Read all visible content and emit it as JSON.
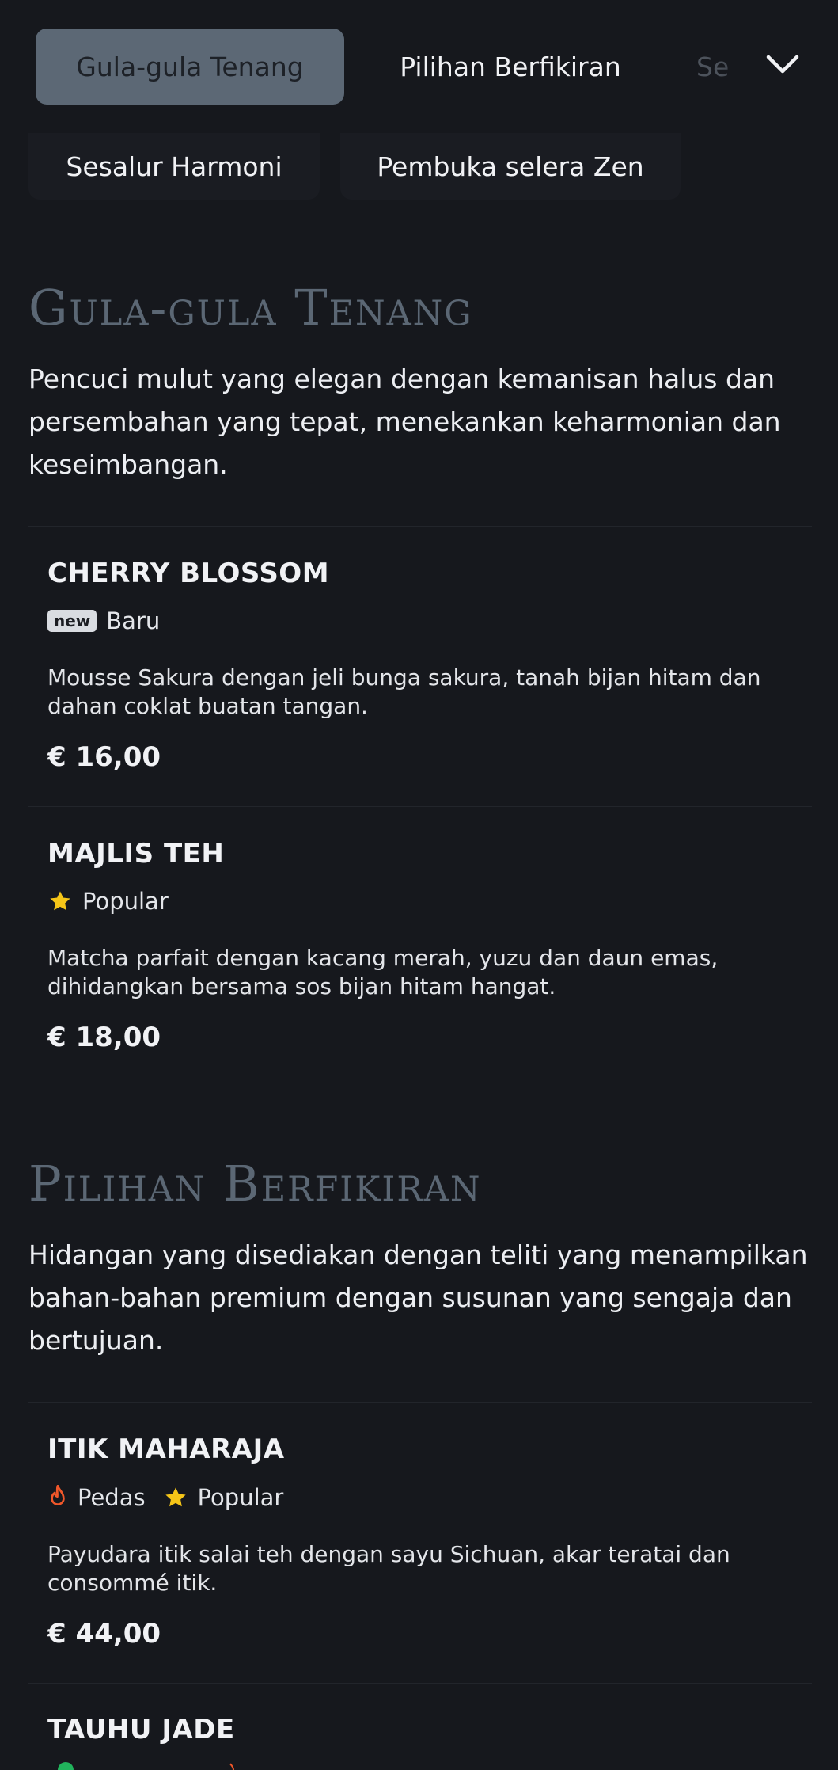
{
  "nav": {
    "categories": [
      {
        "label": "Gula-gula Tenang",
        "active": true
      },
      {
        "label": "Pilihan Berfikiran",
        "active": false
      },
      {
        "label": "Se",
        "active": false
      }
    ],
    "categories_row2": [
      {
        "label": "Sesalur Harmoni"
      },
      {
        "label": "Pembuka selera Zen"
      }
    ]
  },
  "sections": [
    {
      "title": "Gula-gula Tenang",
      "description": "Pencuci mulut yang elegan dengan kemanisan halus dan persembahan yang tepat, menekankan keharmonian dan keseimbangan.",
      "items": [
        {
          "name": "CHERRY BLOSSOM",
          "tags": [
            {
              "icon": "new-badge",
              "badge": "new",
              "label": "Baru"
            }
          ],
          "description": "Mousse Sakura dengan jeli bunga sakura, tanah bijan hitam dan dahan coklat buatan tangan.",
          "price": "€ 16,00"
        },
        {
          "name": "MAJLIS TEH",
          "tags": [
            {
              "icon": "star-icon",
              "label": "Popular"
            }
          ],
          "description": "Matcha parfait dengan kacang merah, yuzu dan daun emas, dihidangkan bersama sos bijan hitam hangat.",
          "price": "€ 18,00"
        }
      ]
    },
    {
      "title": "Pilihan Berfikiran",
      "description": "Hidangan yang disediakan dengan teliti yang menampilkan bahan-bahan premium dengan susunan yang sengaja dan bertujuan.",
      "items": [
        {
          "name": "ITIK MAHARAJA",
          "tags": [
            {
              "icon": "flame-icon",
              "label": "Pedas"
            },
            {
              "icon": "star-icon",
              "label": "Popular"
            }
          ],
          "description": "Payudara itik salai teh dengan sayu Sichuan, akar teratai dan consommé itik.",
          "price": "€ 44,00"
        },
        {
          "name": "TAUHU JADE",
          "tags": [],
          "description": "",
          "price": ""
        }
      ]
    }
  ],
  "colors": {
    "background": "#16181d",
    "active_tab": "#5c6875",
    "section_title": "#5b6774",
    "star": "#f5c518",
    "flame": "#f0572a"
  }
}
